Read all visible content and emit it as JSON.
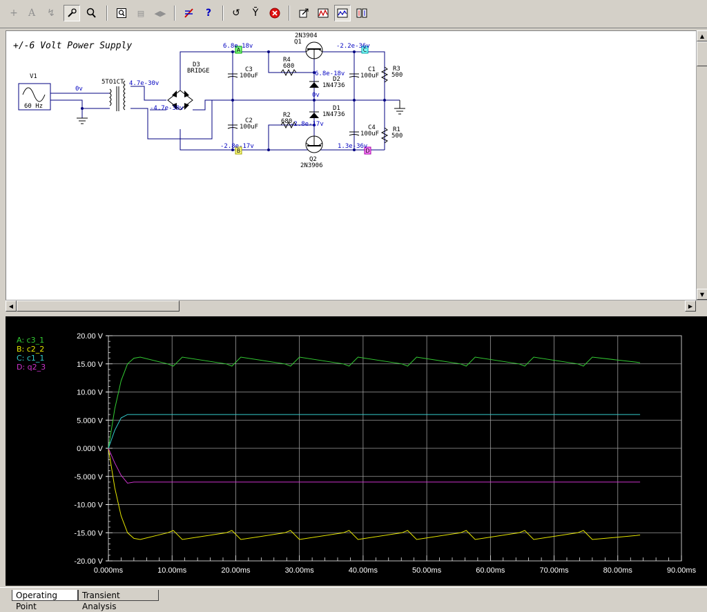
{
  "toolbar": {
    "icons": [
      "plus-icon",
      "text-tool-icon",
      "lightning-icon",
      "probe-icon",
      "zoom-icon",
      "zoom-fit-icon",
      "copy-icon",
      "flip-icon",
      "lines-icon",
      "help-icon",
      "undo-icon",
      "antenna-icon",
      "stop-icon",
      "export-icon",
      "graph-icon",
      "graph-active-icon",
      "graph-split-icon"
    ]
  },
  "schematic": {
    "title": "+/-6 Volt Power Supply",
    "source": {
      "name": "V1",
      "freq": "60 Hz"
    },
    "transformer": "5TO1CT",
    "bridge": {
      "name": "D3",
      "type": "BRIDGE"
    },
    "components": {
      "C3": {
        "name": "C3",
        "value": "100uF"
      },
      "C2": {
        "name": "C2",
        "value": "100uF"
      },
      "C1": {
        "name": "C1",
        "value": "100uF"
      },
      "C4": {
        "name": "C4",
        "value": "100uF"
      },
      "R4": {
        "name": "R4",
        "value": "680"
      },
      "R2": {
        "name": "R2",
        "value": "680"
      },
      "R3": {
        "name": "R3",
        "value": "500"
      },
      "R1": {
        "name": "R1",
        "value": "500"
      },
      "D2": {
        "name": "D2",
        "value": "1N4736"
      },
      "D1": {
        "name": "D1",
        "value": "1N4736"
      },
      "Q1": {
        "name": "Q1",
        "value": "2N3904"
      },
      "Q2": {
        "name": "Q2",
        "value": "2N3906"
      }
    },
    "voltages": {
      "in": "0v",
      "sec_top": "4.7e-30v",
      "sec_bot": "-4.7e-30v",
      "node_a": "6.8e-18v",
      "node_b": "-2.8e-17v",
      "q1_out": "-2.2e-36v",
      "d2_top": "6.8e-18v",
      "mid": "0v",
      "d1_bot": "-2.8e-17v",
      "q2_out": "1.3e-36v"
    },
    "probes": [
      {
        "label": "A",
        "color": "#00c000"
      },
      {
        "label": "B",
        "color": "#c8c800"
      },
      {
        "label": "C",
        "color": "#00c0c0"
      },
      {
        "label": "D",
        "color": "#c000c0"
      }
    ]
  },
  "chart_data": {
    "type": "line",
    "x": [
      0.0,
      1.0,
      2.0,
      3.0,
      4.0,
      5.0,
      9.3,
      10.2,
      11.6,
      18.5,
      19.4,
      20.8,
      27.7,
      28.6,
      30.0,
      36.9,
      37.8,
      39.2,
      46.1,
      47.0,
      48.4,
      55.3,
      56.2,
      57.6,
      64.5,
      65.4,
      66.8,
      73.7,
      74.6,
      76.0,
      82.9,
      83.5
    ],
    "series": [
      {
        "name": "A: c3_1",
        "color": "#33cc33",
        "values": [
          0.0,
          7.0,
          12.0,
          15.0,
          16.0,
          16.2,
          15.0,
          14.6,
          16.2,
          15.0,
          14.6,
          16.2,
          15.0,
          14.6,
          16.2,
          15.0,
          14.6,
          16.2,
          15.0,
          14.6,
          16.2,
          15.0,
          14.6,
          16.2,
          15.0,
          14.6,
          16.2,
          15.0,
          14.6,
          16.2,
          15.3,
          15.2
        ]
      },
      {
        "name": "B: c2_2",
        "color": "#e6e600",
        "values": [
          0.0,
          -7.0,
          -12.0,
          -15.0,
          -16.0,
          -16.2,
          -15.0,
          -14.6,
          -16.2,
          -15.0,
          -14.6,
          -16.2,
          -15.0,
          -14.6,
          -16.2,
          -15.0,
          -14.6,
          -16.2,
          -15.0,
          -14.6,
          -16.2,
          -15.0,
          -14.6,
          -16.2,
          -15.0,
          -14.6,
          -16.2,
          -15.0,
          -14.6,
          -16.2,
          -15.5,
          -15.4
        ]
      },
      {
        "name": "C: c1_1",
        "color": "#33cccc",
        "values": [
          0.0,
          3.2,
          5.4,
          6.0,
          6.0,
          6.0,
          6.0,
          6.0,
          6.0,
          6.0,
          6.0,
          6.0,
          6.0,
          6.0,
          6.0,
          6.0,
          6.0,
          6.0,
          6.0,
          6.0,
          6.0,
          6.0,
          6.0,
          6.0,
          6.0,
          6.0,
          6.0,
          6.0,
          6.0,
          6.0,
          6.0,
          6.0
        ]
      },
      {
        "name": "D: q2_3",
        "color": "#cc33cc",
        "values": [
          0.0,
          -2.6,
          -4.8,
          -6.2,
          -6.0,
          -6.0,
          -6.0,
          -6.0,
          -6.0,
          -6.0,
          -6.0,
          -6.0,
          -6.0,
          -6.0,
          -6.0,
          -6.0,
          -6.0,
          -6.0,
          -6.0,
          -6.0,
          -6.0,
          -6.0,
          -6.0,
          -6.0,
          -6.0,
          -6.0,
          -6.0,
          -6.0,
          -6.0,
          -6.0,
          -6.0,
          -6.0
        ]
      }
    ],
    "yticks": [
      "20.00 V",
      "15.00 V",
      "10.00 V",
      "5.000 V",
      "0.000 V",
      "-5.000 V",
      "-10.00 V",
      "-15.00 V",
      "-20.00 V"
    ],
    "xticks": [
      "0.000ms",
      "10.00ms",
      "20.00ms",
      "30.00ms",
      "40.00ms",
      "50.00ms",
      "60.00ms",
      "70.00ms",
      "80.00ms",
      "90.00ms"
    ],
    "xlim": [
      0,
      90
    ],
    "ylim": [
      -20,
      20
    ],
    "grid": true,
    "legend": "top-left"
  },
  "tabs": [
    {
      "label": "Operating Point",
      "active": true
    },
    {
      "label": "Transient Analysis",
      "active": false
    }
  ]
}
